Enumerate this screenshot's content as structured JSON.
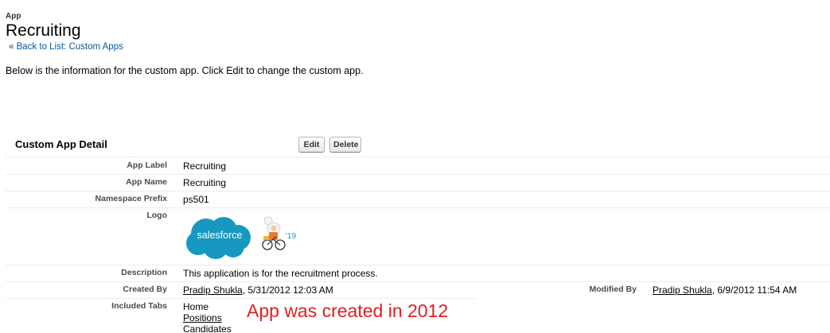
{
  "header": {
    "type_label": "App",
    "title": "Recruiting",
    "back_prefix": "«",
    "back_link": "Back to List: Custom Apps"
  },
  "intro_text": "Below is the information for the custom app. Click Edit to change the custom app.",
  "detail": {
    "section_title": "Custom App Detail",
    "edit_label": "Edit",
    "delete_label": "Delete",
    "app_label": {
      "label": "App Label",
      "value": "Recruiting"
    },
    "app_name": {
      "label": "App Name",
      "value": "Recruiting"
    },
    "namespace_prefix": {
      "label": "Namespace Prefix",
      "value": "ps501"
    },
    "logo": {
      "label": "Logo",
      "brand_text": "salesforce",
      "badge_text": "'19",
      "cloud_color": "#1798c1"
    },
    "description": {
      "label": "Description",
      "value": "This application is for the recruitment process."
    },
    "created_by": {
      "label": "Created By",
      "user": "Pradip Shukla",
      "date": ", 5/31/2012 12:03 AM"
    },
    "modified_by": {
      "label": "Modified By",
      "user": "Pradip Shukla",
      "date": ", 6/9/2012 11:54 AM"
    },
    "included_tabs": {
      "label": "Included Tabs",
      "tabs": [
        "Home",
        "Positions",
        "Candidates"
      ]
    }
  },
  "annotation": {
    "text": "App was created in 2012",
    "color": "#e02020"
  }
}
